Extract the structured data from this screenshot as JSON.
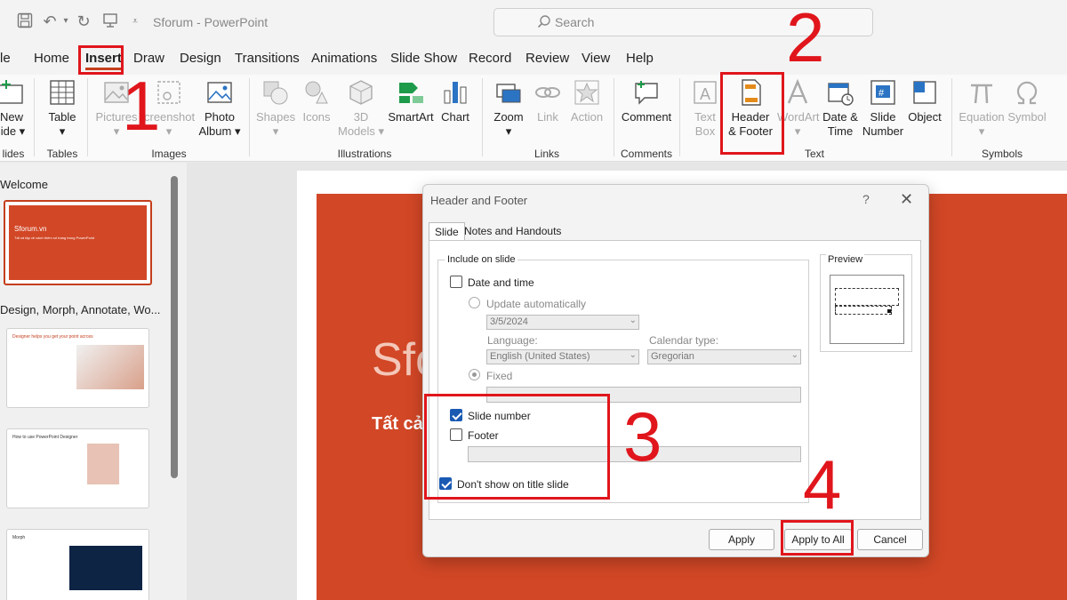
{
  "app": {
    "title": "Sforum  -  PowerPoint"
  },
  "search": {
    "placeholder": "Search"
  },
  "tabs": [
    "le",
    "Home",
    "Insert",
    "Draw",
    "Design",
    "Transitions",
    "Animations",
    "Slide Show",
    "Record",
    "Review",
    "View",
    "Help"
  ],
  "ribbon": {
    "new_slide": [
      "New",
      "lide ▾"
    ],
    "table": [
      "Table",
      "▾"
    ],
    "pictures": [
      "Pictures",
      "▾"
    ],
    "screenshot": [
      "creenshot",
      "▾"
    ],
    "photo_album": [
      "Photo",
      "Album ▾"
    ],
    "shapes": [
      "Shapes",
      "▾"
    ],
    "icons": [
      "Icons"
    ],
    "models_3d": [
      "3D",
      "Models ▾"
    ],
    "smartart": [
      "SmartArt"
    ],
    "chart": [
      "Chart"
    ],
    "zoom": [
      "Zoom",
      "▾"
    ],
    "link": [
      "Link"
    ],
    "action": [
      "Action"
    ],
    "comment": [
      "Comment"
    ],
    "text_box": [
      "Text",
      "Box"
    ],
    "header_footer": [
      "Header",
      "& Footer"
    ],
    "wordart": [
      "WordArt",
      "▾"
    ],
    "date_time": [
      "Date &",
      "Time"
    ],
    "slide_number": [
      "Slide",
      "Number"
    ],
    "object": [
      "Object"
    ],
    "equation": [
      "Equation",
      "▾"
    ],
    "symbol": [
      "Symbol"
    ],
    "groups": {
      "slides": "lides",
      "tables": "Tables",
      "images": "Images",
      "illustrations": "Illustrations",
      "links": "Links",
      "comments": "Comments",
      "text": "Text",
      "symbols": "Symbols"
    }
  },
  "thumbnails": {
    "section1": "Welcome",
    "section2": "Design, Morph, Annotate, Wo...",
    "slide1_title": "Sforum.vn",
    "slide1_sub": "Tất cả tập về cách thêm số trang trong PowerPoint",
    "slide2_title": "Designer helps you get your point across",
    "slide3_title": "How to use PowerPoint Designer",
    "slide4_title": "Morph"
  },
  "slide": {
    "title": "Sfor",
    "subtitle": "Tất cả"
  },
  "dialog": {
    "title": "Header and Footer",
    "help": "?",
    "close": "✕",
    "tab_slide": "Slide",
    "tab_notes": "Notes and Handouts",
    "include_legend": "Include on slide",
    "date_time": "Date and time",
    "update_auto": "Update automatically",
    "date_value": "3/5/2024",
    "language_label": "Language:",
    "language_value": "English (United States)",
    "calendar_label": "Calendar type:",
    "calendar_value": "Gregorian",
    "fixed": "Fixed",
    "slide_number": "Slide number",
    "footer": "Footer",
    "dont_show": "Don't show on title slide",
    "preview": "Preview",
    "apply": "Apply",
    "apply_all": "Apply to All",
    "cancel": "Cancel"
  },
  "annotations": [
    "1",
    "2",
    "3",
    "4"
  ],
  "colors": {
    "accent": "#c43e1c",
    "slide": "#d24726",
    "annotation": "#e0161c",
    "checkbox": "#1a5ab3"
  }
}
